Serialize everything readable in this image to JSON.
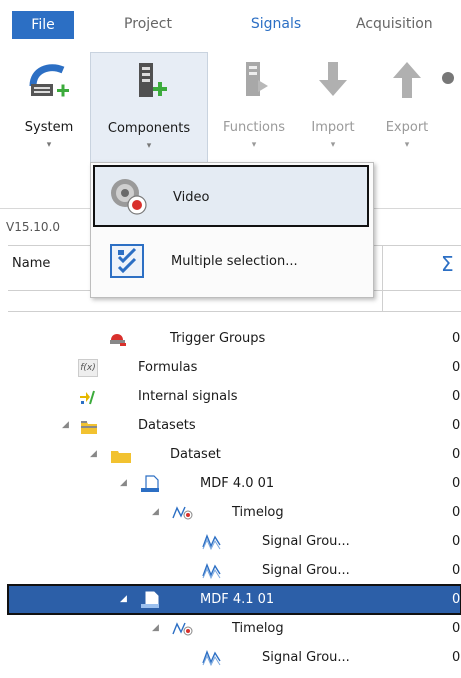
{
  "menu": {
    "tabs": [
      "File",
      "Project",
      "Signals",
      "Acquisition"
    ]
  },
  "ribbon": {
    "buttons": [
      {
        "label": "System",
        "icon": "system-icon"
      },
      {
        "label": "Components",
        "icon": "components-icon"
      },
      {
        "label": "Functions",
        "icon": "functions-icon"
      },
      {
        "label": "Import",
        "icon": "import-arrow-icon"
      },
      {
        "label": "Export",
        "icon": "export-arrow-icon"
      }
    ],
    "dropdown_glyph": "▾"
  },
  "dropdown": {
    "items": [
      {
        "label": "Video",
        "icon": "video-icon"
      },
      {
        "label": "Multiple selection...",
        "icon": "multiple-selection-icon"
      }
    ]
  },
  "version_label": "V15.10.0",
  "grid": {
    "columns": [
      "Name",
      "Σ"
    ]
  },
  "tree": {
    "rows": [
      {
        "label": "Trigger Groups",
        "value": "0",
        "icon": "trigger-groups-icon"
      },
      {
        "label": "Formulas",
        "value": "0",
        "icon": "formula-icon",
        "icon_text": "f(x)"
      },
      {
        "label": "Internal signals",
        "value": "0",
        "icon": "internal-signals-icon"
      },
      {
        "label": "Datasets",
        "value": "0",
        "icon": "folder-icon"
      },
      {
        "label": "Dataset",
        "value": "0",
        "icon": "folder-icon"
      },
      {
        "label": "MDF 4.0 01",
        "value": "0",
        "icon": "mdf-file-icon"
      },
      {
        "label": "Timelog",
        "value": "0",
        "icon": "timelog-icon"
      },
      {
        "label": "Signal Grou...",
        "value": "0",
        "icon": "signal-group-icon"
      },
      {
        "label": "Signal Grou...",
        "value": "0",
        "icon": "signal-group-icon"
      },
      {
        "label": "MDF 4.1 01",
        "value": "0",
        "icon": "mdf-file-icon",
        "selected": true
      },
      {
        "label": "Timelog",
        "value": "0",
        "icon": "timelog-icon"
      },
      {
        "label": "Signal Grou...",
        "value": "0",
        "icon": "signal-group-icon"
      }
    ]
  },
  "colors": {
    "accent": "#2c6fc4",
    "selection": "#2c5fa8",
    "folder": "#f2c230",
    "add_green": "#3cab3c"
  }
}
